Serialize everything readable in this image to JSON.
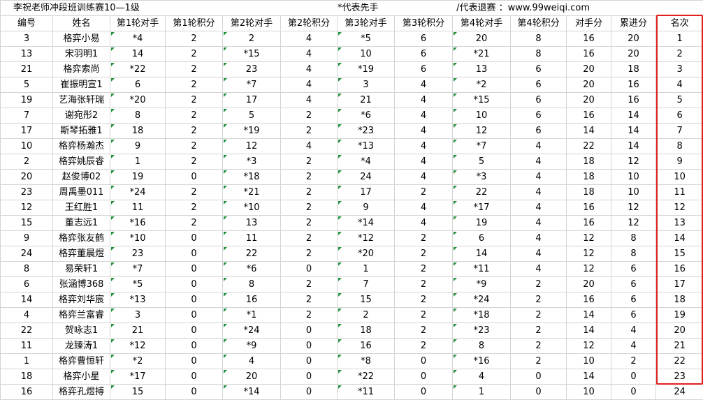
{
  "title": "李祝老师冲段班训练赛10—1级",
  "note_first": "*代表先手",
  "note_quit": "/代表退赛",
  "note_colon": "：",
  "website": "www.99weiqi.com",
  "headers": [
    "编号",
    "姓名",
    "第1轮对手",
    "第1轮积分",
    "第2轮对手",
    "第2轮积分",
    "第3轮对手",
    "第3轮积分",
    "第4轮对手",
    "第4轮积分",
    "对手分",
    "累进分",
    "名次"
  ],
  "rows": [
    [
      "3",
      "格弈小易",
      "*4",
      "2",
      "2",
      "4",
      "*5",
      "6",
      "20",
      "8",
      "16",
      "20",
      "1"
    ],
    [
      "13",
      "宋羽明1",
      "14",
      "2",
      "*15",
      "4",
      "10",
      "6",
      "*21",
      "8",
      "16",
      "20",
      "2"
    ],
    [
      "21",
      "格弈索尚",
      "*22",
      "2",
      "23",
      "4",
      "*19",
      "6",
      "13",
      "6",
      "20",
      "18",
      "3"
    ],
    [
      "5",
      "崔振明宣1",
      "6",
      "2",
      "*7",
      "4",
      "3",
      "4",
      "*2",
      "6",
      "20",
      "16",
      "4"
    ],
    [
      "19",
      "艺海张轩瑞",
      "*20",
      "2",
      "17",
      "4",
      "21",
      "4",
      "*15",
      "6",
      "20",
      "16",
      "5"
    ],
    [
      "7",
      "谢宛彤2",
      "8",
      "2",
      "5",
      "2",
      "*6",
      "4",
      "10",
      "6",
      "16",
      "14",
      "6"
    ],
    [
      "17",
      "斯琴拓雅1",
      "18",
      "2",
      "*19",
      "2",
      "*23",
      "4",
      "12",
      "6",
      "14",
      "14",
      "7"
    ],
    [
      "10",
      "格弈杨瀚杰",
      "9",
      "2",
      "12",
      "4",
      "*13",
      "4",
      "*7",
      "4",
      "22",
      "14",
      "8"
    ],
    [
      "2",
      "格弈姚辰睿",
      "1",
      "2",
      "*3",
      "2",
      "*4",
      "4",
      "5",
      "4",
      "18",
      "12",
      "9"
    ],
    [
      "20",
      "赵俊博02",
      "19",
      "0",
      "*18",
      "2",
      "24",
      "4",
      "*3",
      "4",
      "18",
      "10",
      "10"
    ],
    [
      "23",
      "周禹墨011",
      "*24",
      "2",
      "*21",
      "2",
      "17",
      "2",
      "22",
      "4",
      "18",
      "10",
      "11"
    ],
    [
      "12",
      "王红胜1",
      "11",
      "2",
      "*10",
      "2",
      "9",
      "4",
      "*17",
      "4",
      "16",
      "12",
      "12"
    ],
    [
      "15",
      "董志远1",
      "*16",
      "2",
      "13",
      "2",
      "*14",
      "4",
      "19",
      "4",
      "16",
      "12",
      "13"
    ],
    [
      "9",
      "格弈张友鹤",
      "*10",
      "0",
      "11",
      "2",
      "*12",
      "2",
      "6",
      "4",
      "12",
      "8",
      "14"
    ],
    [
      "24",
      "格弈董晨煜",
      "23",
      "0",
      "22",
      "2",
      "*20",
      "2",
      "14",
      "4",
      "12",
      "8",
      "15"
    ],
    [
      "8",
      "易荣轩1",
      "*7",
      "0",
      "*6",
      "0",
      "1",
      "2",
      "*11",
      "4",
      "12",
      "6",
      "16"
    ],
    [
      "6",
      "张涵博368",
      "*5",
      "0",
      "8",
      "2",
      "7",
      "2",
      "*9",
      "2",
      "20",
      "6",
      "17"
    ],
    [
      "14",
      "格弈刘华宸",
      "*13",
      "0",
      "16",
      "2",
      "15",
      "2",
      "*24",
      "2",
      "16",
      "6",
      "18"
    ],
    [
      "4",
      "格弈兰富睿",
      "3",
      "0",
      "*1",
      "2",
      "2",
      "2",
      "*18",
      "2",
      "14",
      "6",
      "19"
    ],
    [
      "22",
      "贺咏志1",
      "21",
      "0",
      "*24",
      "0",
      "18",
      "2",
      "*23",
      "2",
      "14",
      "4",
      "20"
    ],
    [
      "11",
      "龙臻涛1",
      "*12",
      "0",
      "*9",
      "0",
      "16",
      "2",
      "8",
      "2",
      "12",
      "4",
      "21"
    ],
    [
      "1",
      "格弈曹恒轩",
      "*2",
      "0",
      "4",
      "0",
      "*8",
      "0",
      "*16",
      "2",
      "10",
      "2",
      "22"
    ],
    [
      "18",
      "格弈小星",
      "*17",
      "0",
      "20",
      "0",
      "*22",
      "0",
      "4",
      "0",
      "14",
      "0",
      "23"
    ],
    [
      "16",
      "格弈孔煜搏",
      "15",
      "0",
      "*14",
      "0",
      "*11",
      "0",
      "1",
      "0",
      "10",
      "0",
      "24"
    ]
  ]
}
